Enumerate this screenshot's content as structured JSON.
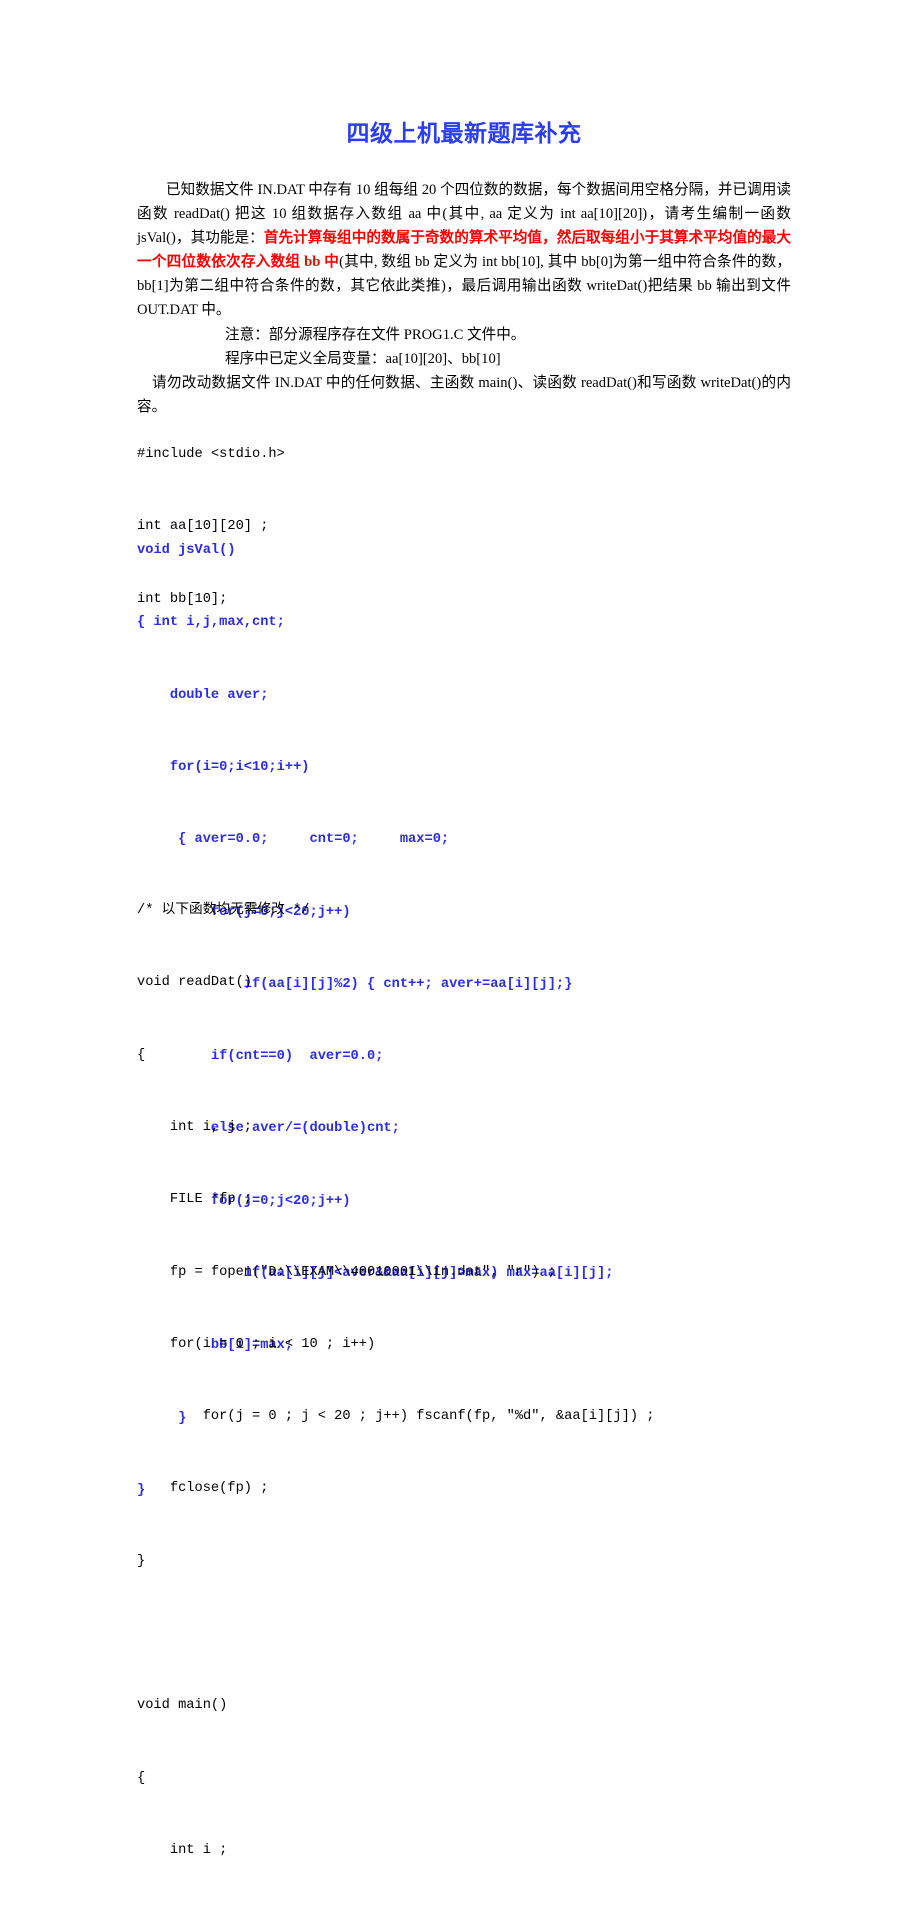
{
  "document": {
    "title": "四级上机最新题库补充",
    "title_color": "#2b3df0",
    "highlight_color": "#fe0000",
    "code_color": "#2b2bee"
  },
  "body": {
    "paragraph1_prefix": "已知数据文件 IN.DAT 中存有 10 组每组 20 个四位数的数据，每个数据间用空格分隔，并已调用读函数 readDat() 把这 10 组数据存入数组 aa 中(其中, aa 定义为 int aa[10][20])，请考生编制一函数 jsVal()，其功能是：",
    "paragraph1_red": "首先计算每组中的数属于奇数的算术平均值，然后取每组小于其算术平均值的最大一个四位数依次存入数组 bb 中",
    "paragraph1_suffix": "(其中, 数组 bb 定义为 int bb[10], 其中 bb[0]为第一组中符合条件的数，bb[1]为第二组中符合条件的数，其它依此类推)，最后调用输出函数 writeDat()把结果 bb 输出到文件 OUT.DAT 中。",
    "note1": "注意：部分源程序存在文件 PROG1.C 文件中。",
    "note2": "程序中已定义全局变量：aa[10][20]、bb[10]",
    "note3": "请勿改动数据文件 IN.DAT 中的任何数据、主函数 main()、读函数 readDat()和写函数 writeDat()的内容。"
  },
  "code": {
    "declarations": [
      "#include <stdio.h>",
      "int aa[10][20] ;",
      "int bb[10];"
    ],
    "jsval_function": [
      "void jsVal()",
      "{ int i,j,max,cnt;",
      "    double aver;",
      "    for(i=0;i<10;i++)",
      "     { aver=0.0;     cnt=0;     max=0;",
      "         for(j=0;j<20;j++)",
      "             if(aa[i][j]%2) { cnt++; aver+=aa[i][j];}",
      "         if(cnt==0)  aver=0.0;",
      "         else aver/=(double)cnt;",
      "         for(j=0;j<20;j++)",
      "             if(aa[i][j]<aver&&aa[i][j]>max) max=aa[i][j];",
      "         bb[i]=max;",
      "     }",
      "}"
    ],
    "remaining_functions": [
      "/* 以下函数均无需修改 */",
      "void readDat()",
      "{",
      "    int i, j ;",
      "    FILE *fp ;",
      "    fp = fopen(\"D:\\\\EXAM\\\\40010001\\\\in.dat\", \"r\") ;",
      "    for(i = 0 ; i < 10 ; i++)",
      "        for(j = 0 ; j < 20 ; j++) fscanf(fp, \"%d\", &aa[i][j]) ;",
      "    fclose(fp) ;",
      "}",
      "",
      "void main()",
      "{",
      "    int i ;"
    ]
  }
}
